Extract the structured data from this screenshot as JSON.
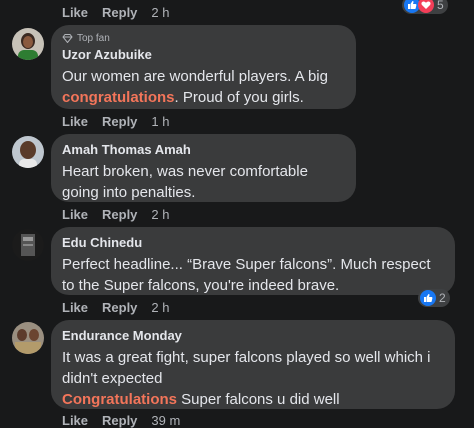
{
  "top_row": {
    "like": "Like",
    "reply": "Reply",
    "time": "2 h",
    "reaction_count": "5"
  },
  "comments": [
    {
      "badge": "Top fan",
      "author": "Uzor Azubuike",
      "text_before": "Our women are wonderful players. A big",
      "highlight": "congratulations",
      "text_after": ". Proud of you girls.",
      "like": "Like",
      "reply": "Reply",
      "time": "1 h"
    },
    {
      "author": "Amah Thomas Amah",
      "text": "Heart broken, was never comfortable going into penalties.",
      "like": "Like",
      "reply": "Reply",
      "time": "2 h"
    },
    {
      "author": "Edu Chinedu",
      "text": "Perfect headline... “Brave Super falcons”. Much respect to the Super falcons, you're indeed brave.",
      "like": "Like",
      "reply": "Reply",
      "time": "2 h",
      "reaction_count": "2"
    },
    {
      "author": "Endurance Monday",
      "text": "It was a great fight, super falcons played so well which i didn't expected",
      "highlight": "Congratulations",
      "text_after": " Super falcons u did well",
      "like": "Like",
      "reply": "Reply",
      "time": "39 m"
    }
  ],
  "colors": {
    "background": "#18191a",
    "bubble": "#3a3b3c",
    "highlight": "#f3755a",
    "like_blue": "#1877f2",
    "love_red": "#f33e58"
  }
}
